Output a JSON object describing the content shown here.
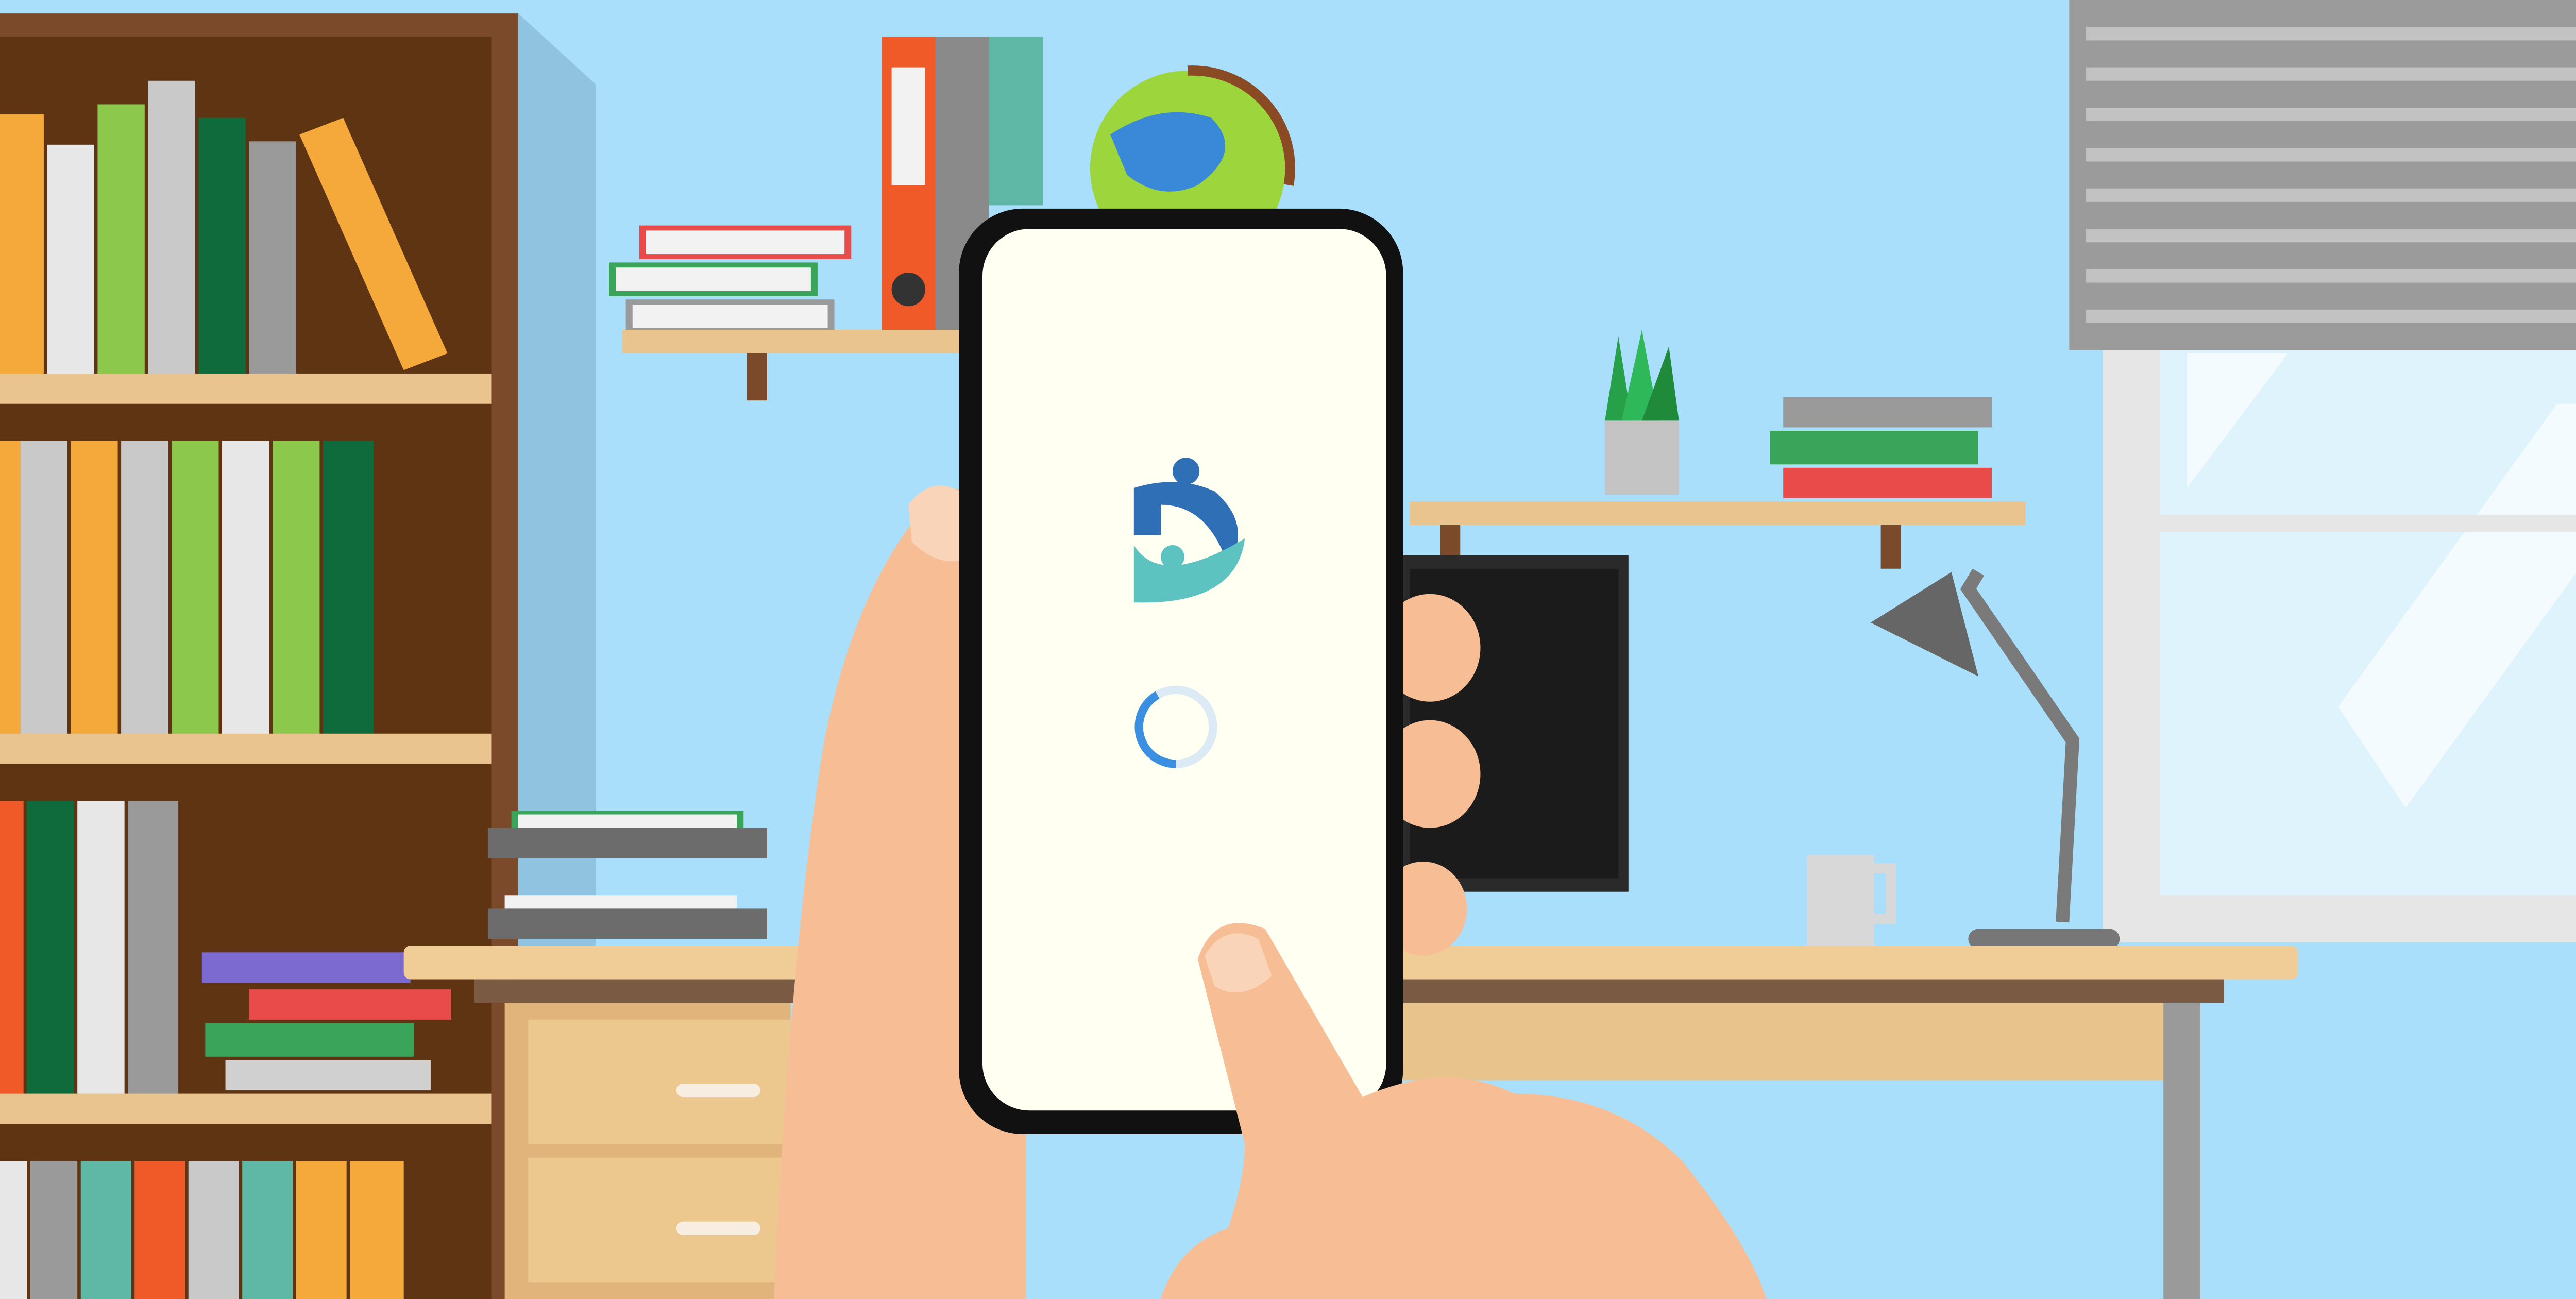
{
  "scene": {
    "description_free": true,
    "app_screen": {
      "logo_icon": "app-logo-icon",
      "spinner_icon": "loading-spinner-icon",
      "loading_progress": 0.3
    },
    "colors": {
      "wall": "#a9dffb",
      "screen_bg": "#fffff2",
      "logo_blue": "#2f6fb6",
      "logo_teal": "#5cc3c1",
      "spinner_active": "#3a8fe0",
      "spinner_track": "#dbeaf5",
      "skin": "#f7bd95",
      "phone_frame": "#111111"
    }
  }
}
